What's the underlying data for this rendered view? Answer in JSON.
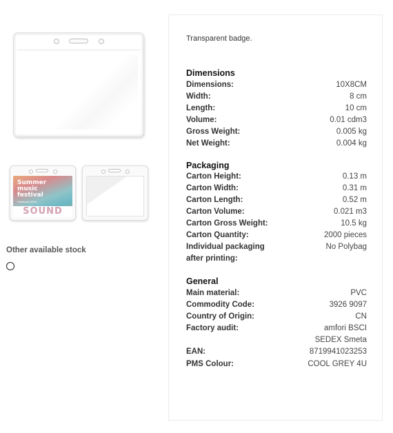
{
  "product": {
    "description": "Transparent badge.",
    "thumb1": {
      "poster_title": "Summer music festival",
      "poster_subtitle": "Fairbeach 2015",
      "poster_word": "SOUND"
    }
  },
  "stock": {
    "label": "Other available stock"
  },
  "specs": {
    "dimensions": {
      "title": "Dimensions",
      "rows": [
        {
          "k": "Dimensions:",
          "v": "10X8CM"
        },
        {
          "k": "Width:",
          "v": "8 cm"
        },
        {
          "k": "Length:",
          "v": "10 cm"
        },
        {
          "k": "Volume:",
          "v": "0.01 cdm3"
        },
        {
          "k": "Gross Weight:",
          "v": "0.005 kg"
        },
        {
          "k": "Net Weight:",
          "v": "0.004 kg"
        }
      ]
    },
    "packaging": {
      "title": "Packaging",
      "rows": [
        {
          "k": "Carton Height:",
          "v": "0.13 m"
        },
        {
          "k": "Carton Width:",
          "v": "0.31 m"
        },
        {
          "k": "Carton Length:",
          "v": "0.52 m"
        },
        {
          "k": "Carton Volume:",
          "v": "0.021 m3"
        },
        {
          "k": "Carton Gross Weight:",
          "v": "10.5 kg"
        },
        {
          "k": "Carton Quantity:",
          "v": "2000 pieces"
        },
        {
          "k": "Individual packaging",
          "v": "No Polybag"
        },
        {
          "k": "after printing:",
          "v": ""
        }
      ]
    },
    "general": {
      "title": "General",
      "rows": [
        {
          "k": "Main material:",
          "v": "PVC"
        },
        {
          "k": "Commodity Code:",
          "v": "3926 9097"
        },
        {
          "k": "Country of Origin:",
          "v": "CN"
        },
        {
          "k": "Factory audit:",
          "v": "amfori BSCI"
        },
        {
          "k": "",
          "v": "SEDEX Smeta"
        },
        {
          "k": "EAN:",
          "v": "8719941023253"
        },
        {
          "k": "PMS Colour:",
          "v": "COOL GREY 4U"
        }
      ]
    }
  }
}
